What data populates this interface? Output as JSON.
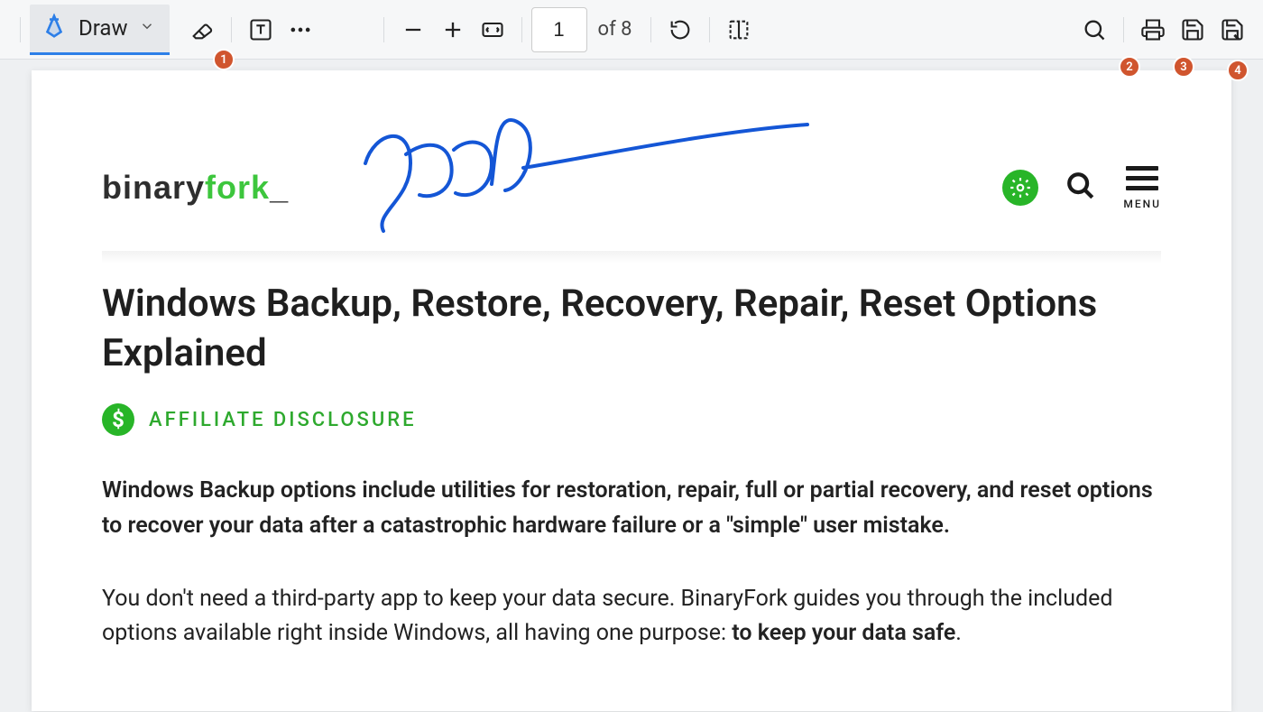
{
  "toolbar": {
    "draw_label": "Draw",
    "page_current": "1",
    "page_total": "of 8"
  },
  "badges": {
    "b1": "1",
    "b2": "2",
    "b3": "3",
    "b4": "4"
  },
  "site": {
    "logo_part1": "binary",
    "logo_part2": "fork",
    "logo_cursor": "_",
    "menu_label": "MENU"
  },
  "article": {
    "title": "Windows Backup, Restore, Recovery, Repair, Reset Options Explained",
    "affiliate": "AFFILIATE DISCLOSURE",
    "p1": "Windows Backup options include utilities for restoration, repair, full or partial recovery, and reset options to recover your data after a catastrophic hardware failure or a \"simple\" user mistake.",
    "p2a": "You don't need a third-party app to keep your data secure. BinaryFork guides you through the included options available right inside Windows, all having one purpose: ",
    "p2b": "to keep your data safe",
    "p2c": "."
  }
}
